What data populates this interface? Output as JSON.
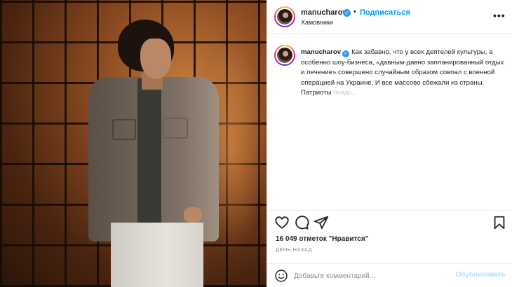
{
  "post": {
    "username": "manucharov",
    "follow_label": "Подписаться",
    "separator": "•",
    "location": "Хамовники",
    "more_label": "•••"
  },
  "caption": {
    "username": "manucharov",
    "text": "Как забавно, что у всех деятелей культуры, а особенно шоу-бизнеса, «давным-давно запланированный отдых и лечение» совершено случайным образом совпал с военной операцией на Украине. И все массово сбежали из страны. Патриоты",
    "fade_text": "блядь..."
  },
  "actions": {
    "like_icon": "heart-icon",
    "comment_icon": "comment-icon",
    "share_icon": "share-icon",
    "save_icon": "bookmark-icon"
  },
  "likes_text": "16 049 отметок \"Нравится\"",
  "time_text": "День назад",
  "comment": {
    "placeholder": "Добавьте комментарий...",
    "publish_label": "Опубликовать"
  },
  "colors": {
    "accent": "#0095f6",
    "verified": "#3897f0",
    "publish_disabled": "#b2dffc"
  }
}
